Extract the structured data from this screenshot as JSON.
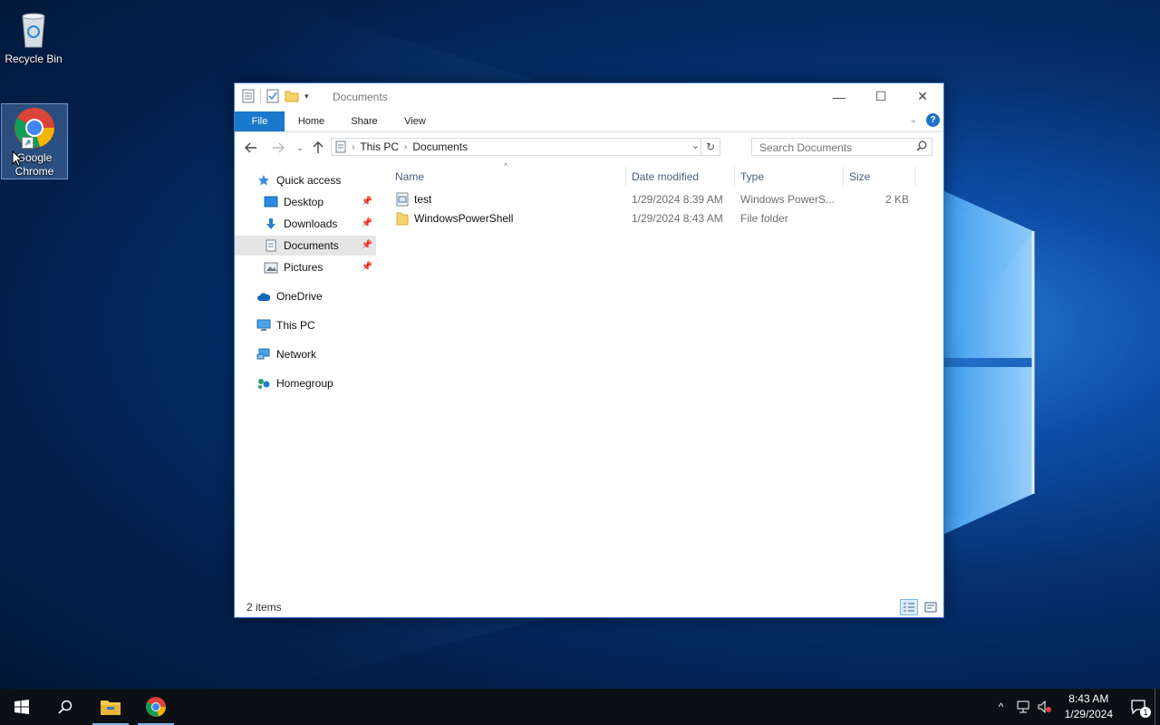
{
  "desktop": {
    "icons": [
      {
        "label": "Recycle Bin"
      },
      {
        "label_line1": "Google",
        "label_line2": "Chrome"
      }
    ]
  },
  "window": {
    "title": "Documents",
    "controls": {
      "minimize": "—",
      "maximize": "☐",
      "close": "✕"
    }
  },
  "ribbon": {
    "tabs": [
      "File",
      "Home",
      "Share",
      "View"
    ],
    "help": "?"
  },
  "address": {
    "crumbs": [
      "This PC",
      "Documents"
    ],
    "search_placeholder": "Search Documents"
  },
  "nav_pane": {
    "quick_access": "Quick access",
    "pinned": [
      "Desktop",
      "Downloads",
      "Documents",
      "Pictures"
    ],
    "others": [
      "OneDrive",
      "This PC",
      "Network",
      "Homegroup"
    ],
    "selected": "Documents"
  },
  "columns": [
    "Name",
    "Date modified",
    "Type",
    "Size"
  ],
  "files": [
    {
      "name": "test",
      "date": "1/29/2024 8:39 AM",
      "type": "Windows PowerS...",
      "size": "2 KB",
      "icon": "script-file-icon"
    },
    {
      "name": "WindowsPowerShell",
      "date": "1/29/2024 8:43 AM",
      "type": "File folder",
      "size": "",
      "icon": "folder-icon"
    }
  ],
  "status": {
    "item_count": "2 items"
  },
  "taskbar": {
    "time": "8:43 AM",
    "date": "1/29/2024",
    "notification_count": "1"
  },
  "colors": {
    "accent": "#1979ca",
    "selection": "#e5e5e5",
    "taskbar": "#0c0f14"
  }
}
